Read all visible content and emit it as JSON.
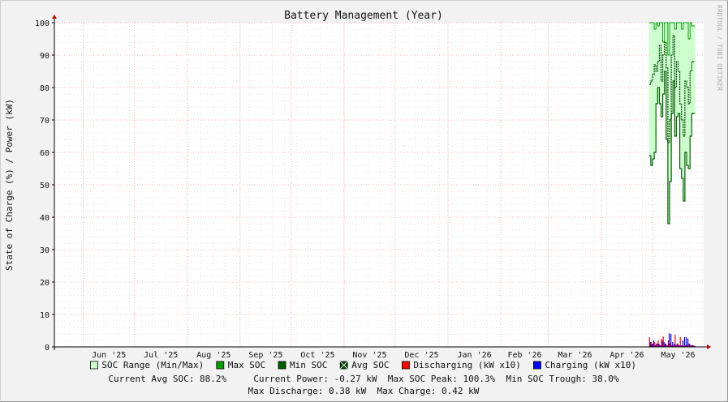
{
  "watermark": "RRDTOOL / TOBI OETIKER",
  "summary": {
    "line1": "Current Avg SOC: 88.2%     Current Power: -0.27 kW  Max SOC Peak: 100.3%  Min SOC Trough: 38.0%",
    "line2": "Max Discharge: 0.38 kW  Max Charge: 0.42 kW"
  },
  "colors": {
    "soc_range": "#ccffcc",
    "max_soc": "#00a000",
    "min_soc": "#006000",
    "avg_soc": "#004000",
    "discharging": "#ff0000",
    "charging": "#0000ff",
    "grid_minor": "#e0c8c8",
    "grid_major": "#f08080",
    "axis": "#c00000"
  },
  "chart_data": {
    "type": "line",
    "title": "Battery Management (Year)",
    "ylabel": "State of Charge (%) / Power (kW)",
    "xlabel": "",
    "ylim": [
      0,
      100
    ],
    "yticks": [
      0,
      10,
      20,
      30,
      40,
      50,
      60,
      70,
      80,
      90,
      100
    ],
    "grid": true,
    "legend_position": "bottom",
    "x_range": [
      "2025-05-15",
      "2026-05-31"
    ],
    "x_tick_labels": [
      {
        "date": "2025-06-01",
        "label": "Jun '25"
      },
      {
        "date": "2025-07-01",
        "label": "Jul '25"
      },
      {
        "date": "2025-08-01",
        "label": "Aug '25"
      },
      {
        "date": "2025-09-01",
        "label": "Sep '25"
      },
      {
        "date": "2025-10-01",
        "label": "Oct '25"
      },
      {
        "date": "2025-11-01",
        "label": "Nov '25"
      },
      {
        "date": "2025-12-01",
        "label": "Dec '25"
      },
      {
        "date": "2026-01-01",
        "label": "Jan '26"
      },
      {
        "date": "2026-02-01",
        "label": "Feb '26"
      },
      {
        "date": "2026-03-01",
        "label": "Mar '26"
      },
      {
        "date": "2026-04-01",
        "label": "Apr '26"
      },
      {
        "date": "2026-05-01",
        "label": "May '26"
      }
    ],
    "legend": [
      {
        "key": "soc_range",
        "label": "SOC Range (Min/Max)"
      },
      {
        "key": "max_soc",
        "label": "Max SOC"
      },
      {
        "key": "min_soc",
        "label": "Min SOC"
      },
      {
        "key": "avg_soc",
        "label": "Avg SOC"
      },
      {
        "key": "discharging",
        "label": "Discharging (kW x10)"
      },
      {
        "key": "charging",
        "label": "Charging (kW x10)"
      }
    ],
    "dates": [
      "2026-04-29",
      "2026-04-30",
      "2026-05-01",
      "2026-05-02",
      "2026-05-03",
      "2026-05-04",
      "2026-05-05",
      "2026-05-06",
      "2026-05-07",
      "2026-05-08",
      "2026-05-09",
      "2026-05-10",
      "2026-05-11",
      "2026-05-12",
      "2026-05-13",
      "2026-05-14",
      "2026-05-15",
      "2026-05-16",
      "2026-05-17",
      "2026-05-18",
      "2026-05-19",
      "2026-05-20",
      "2026-05-21",
      "2026-05-22",
      "2026-05-23",
      "2026-05-24",
      "2026-05-25"
    ],
    "series": [
      {
        "name": "Max SOC",
        "key": "max_soc",
        "values": [
          100,
          100,
          100,
          98,
          100,
          99,
          100,
          100,
          94,
          100,
          100,
          90,
          100,
          100,
          100,
          98,
          100,
          100,
          100,
          98,
          100,
          100,
          100,
          95,
          100,
          99,
          99
        ]
      },
      {
        "name": "Min SOC",
        "key": "min_soc",
        "values": [
          59,
          56,
          58,
          60,
          75,
          80,
          75,
          71,
          78,
          85,
          64,
          38,
          51,
          72,
          82,
          65,
          71,
          72,
          55,
          52,
          45,
          60,
          56,
          55,
          65,
          72,
          72
        ]
      },
      {
        "name": "Avg SOC",
        "key": "avg_soc",
        "values": [
          81,
          82,
          84,
          87,
          85,
          88,
          93,
          82,
          90,
          94,
          86,
          63,
          70,
          90,
          96,
          80,
          88,
          85,
          75,
          70,
          65,
          82,
          80,
          75,
          85,
          88,
          88
        ]
      },
      {
        "name": "Discharging (kW x10)",
        "key": "discharging",
        "values": [
          3.0,
          1.5,
          0.8,
          1.5,
          1.0,
          2.0,
          0.5,
          2.5,
          3.2,
          1.0,
          0.5,
          2.0,
          1.0,
          0.5,
          0.5,
          3.8,
          1.0,
          0.5,
          3.0,
          0.5,
          0.3,
          0.5,
          0.5,
          1.0,
          0.5,
          0.5,
          0.3
        ]
      },
      {
        "name": "Charging (kW x10)",
        "key": "charging",
        "values": [
          1.5,
          1.0,
          2.0,
          0.5,
          1.0,
          1.0,
          0.5,
          2.0,
          1.5,
          1.0,
          0.5,
          4.2,
          4.0,
          1.5,
          1.0,
          0.5,
          1.0,
          0.5,
          0.5,
          2.0,
          3.0,
          3.0,
          2.5,
          1.0,
          0.5,
          0.5,
          0.3
        ]
      }
    ]
  }
}
